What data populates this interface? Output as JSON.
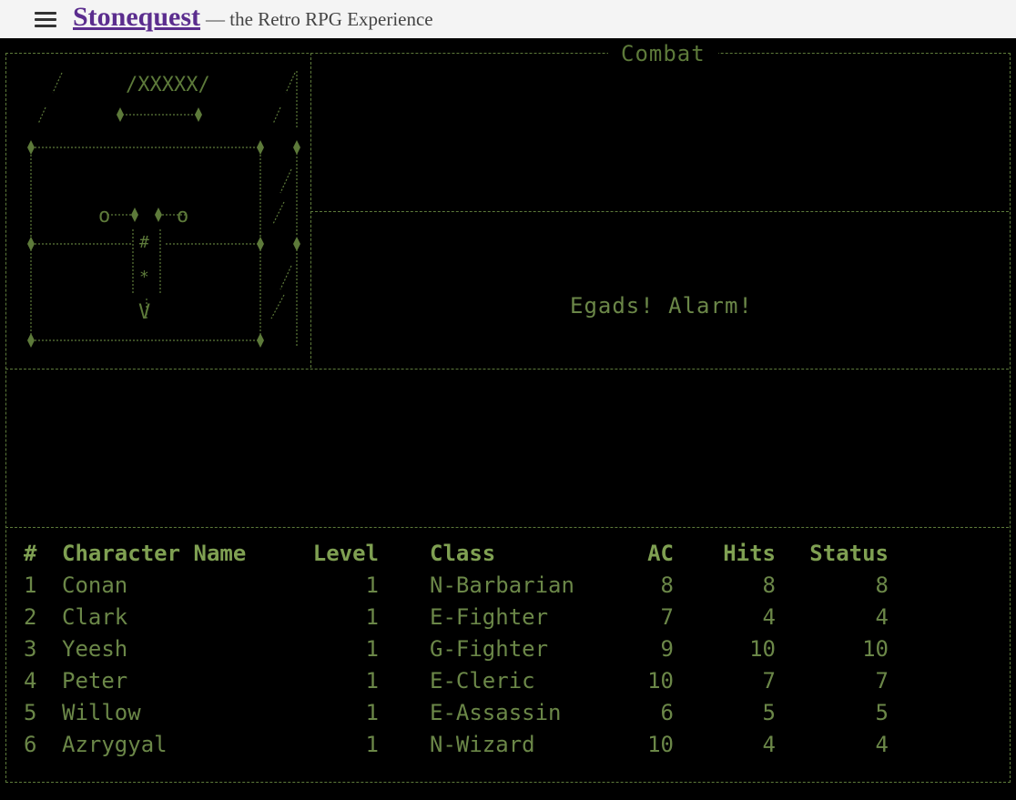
{
  "header": {
    "title": "Stonequest",
    "tagline": "— the Retro RPG Experience"
  },
  "combat": {
    "title": "Combat",
    "message": "Egads!  Alarm!"
  },
  "maze": {
    "door_label": "/XXXXX/"
  },
  "party": {
    "headers": [
      "#",
      "Character Name",
      "Level",
      "Class",
      "AC",
      "Hits",
      "Status"
    ],
    "rows": [
      {
        "num": "1",
        "name": "Conan",
        "level": "1",
        "class": "N-Barbarian",
        "ac": "8",
        "hits": "8",
        "status": "8"
      },
      {
        "num": "2",
        "name": "Clark",
        "level": "1",
        "class": "E-Fighter",
        "ac": "7",
        "hits": "4",
        "status": "4"
      },
      {
        "num": "3",
        "name": "Yeesh",
        "level": "1",
        "class": "G-Fighter",
        "ac": "9",
        "hits": "10",
        "status": "10"
      },
      {
        "num": "4",
        "name": "Peter",
        "level": "1",
        "class": "E-Cleric",
        "ac": "10",
        "hits": "7",
        "status": "7"
      },
      {
        "num": "5",
        "name": "Willow",
        "level": "1",
        "class": "E-Assassin",
        "ac": "6",
        "hits": "5",
        "status": "5"
      },
      {
        "num": "6",
        "name": "Azrygyal",
        "level": "1",
        "class": "N-Wizard",
        "ac": "10",
        "hits": "4",
        "status": "4"
      }
    ]
  },
  "colors": {
    "screen_bg": "#000000",
    "terminal_green": "#6b8748",
    "brand_purple": "#5b2d8e"
  }
}
